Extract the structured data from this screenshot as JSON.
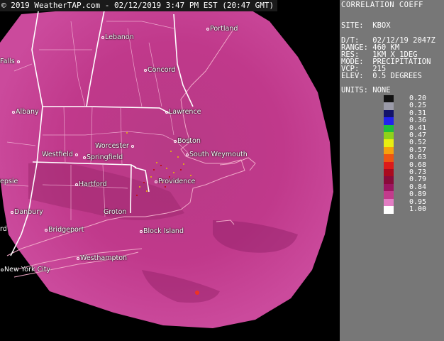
{
  "banner": "© 2019 WeatherTAP.com - 02/12/2019  3:47 PM EST (20:47 GMT)",
  "product_title": "CORRELATION COEFF",
  "meta": [
    {
      "label": "SITE:",
      "value": "KBOX"
    },
    {
      "label": "D/T:",
      "value": "02/12/19 2047Z"
    },
    {
      "label": "RANGE:",
      "value": "460 KM"
    },
    {
      "label": "RES:",
      "value": "1KM X 1DEG"
    },
    {
      "label": "MODE:",
      "value": "PRECIPITATION"
    },
    {
      "label": "VCP:",
      "value": "215"
    },
    {
      "label": "ELEV:",
      "value": "0.5 DEGREES"
    }
  ],
  "units": "UNITS: NONE",
  "legend": [
    {
      "value": "0.20",
      "color": "#111111"
    },
    {
      "value": "0.25",
      "color": "#9a9aa8"
    },
    {
      "value": "0.31",
      "color": "#14146a"
    },
    {
      "value": "0.36",
      "color": "#2222ee"
    },
    {
      "value": "0.41",
      "color": "#1fbf3a"
    },
    {
      "value": "0.47",
      "color": "#8fd21a"
    },
    {
      "value": "0.52",
      "color": "#e8ee10"
    },
    {
      "value": "0.57",
      "color": "#f6a10c"
    },
    {
      "value": "0.63",
      "color": "#ee5512"
    },
    {
      "value": "0.68",
      "color": "#dd1a1a"
    },
    {
      "value": "0.73",
      "color": "#aa0a1e"
    },
    {
      "value": "0.79",
      "color": "#8a0a3a"
    },
    {
      "value": "0.84",
      "color": "#9c1560"
    },
    {
      "value": "0.89",
      "color": "#c23b8c"
    },
    {
      "value": "0.95",
      "color": "#e27cc3"
    },
    {
      "value": "1.00",
      "color": "#ffffff"
    }
  ],
  "cities": [
    {
      "name": "Lebanon"
    },
    {
      "name": "Portland"
    },
    {
      "name": "Falls"
    },
    {
      "name": "Concord"
    },
    {
      "name": "Albany"
    },
    {
      "name": "Lawrence"
    },
    {
      "name": "Worcester"
    },
    {
      "name": "Boston"
    },
    {
      "name": "Westfield"
    },
    {
      "name": "Springfield"
    },
    {
      "name": "South Weymouth"
    },
    {
      "name": "Hartford"
    },
    {
      "name": "Providence"
    },
    {
      "name": "epsie"
    },
    {
      "name": "Danbury"
    },
    {
      "name": "Groton"
    },
    {
      "name": "Block Island"
    },
    {
      "name": "Bridgeport"
    },
    {
      "name": "rd"
    },
    {
      "name": "Westhampton"
    },
    {
      "name": "New York City"
    }
  ],
  "map_colors": {
    "echo": "#c0398b",
    "echo_light": "#d25aa6",
    "lines": "#ffffff",
    "coast": "#f0a8c8"
  }
}
